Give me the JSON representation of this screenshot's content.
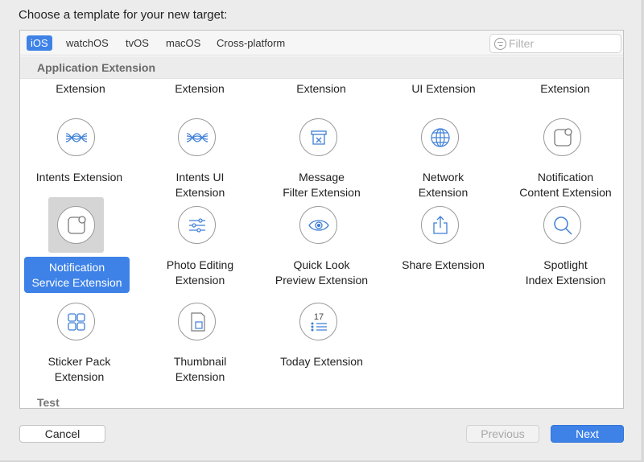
{
  "dialog": {
    "title": "Choose a template for your new target:"
  },
  "tabs": [
    {
      "label": "iOS",
      "active": true
    },
    {
      "label": "watchOS"
    },
    {
      "label": "tvOS"
    },
    {
      "label": "macOS"
    },
    {
      "label": "Cross-platform"
    }
  ],
  "filter": {
    "placeholder": "Filter",
    "value": ""
  },
  "section": {
    "title": "Application Extension",
    "next_title": "Test"
  },
  "partial_row": [
    "Extension",
    "Extension",
    "Extension",
    "UI Extension",
    "Extension"
  ],
  "templates": [
    {
      "line1": "Intents Extension",
      "line2": "",
      "icon": "intents-icon"
    },
    {
      "line1": "Intents UI",
      "line2": "Extension",
      "icon": "intents-ui-icon"
    },
    {
      "line1": "Message",
      "line2": "Filter Extension",
      "icon": "message-filter-icon"
    },
    {
      "line1": "Network",
      "line2": "Extension",
      "icon": "network-globe-icon"
    },
    {
      "line1": "Notification",
      "line2": "Content Extension",
      "icon": "notification-content-icon"
    },
    {
      "line1": "Notification",
      "line2": "Service Extension",
      "icon": "notification-service-icon",
      "selected": true
    },
    {
      "line1": "Photo Editing",
      "line2": "Extension",
      "icon": "photo-editing-sliders-icon"
    },
    {
      "line1": "Quick Look",
      "line2": "Preview Extension",
      "icon": "quick-look-eye-icon"
    },
    {
      "line1": "Share Extension",
      "line2": "",
      "icon": "share-icon"
    },
    {
      "line1": "Spotlight",
      "line2": "Index Extension",
      "icon": "spotlight-search-icon"
    },
    {
      "line1": "Sticker Pack",
      "line2": "Extension",
      "icon": "sticker-pack-icon"
    },
    {
      "line1": "Thumbnail",
      "line2": "Extension",
      "icon": "thumbnail-icon"
    },
    {
      "line1": "Today Extension",
      "line2": "",
      "icon": "today-calendar-icon",
      "date": "17"
    }
  ],
  "buttons": {
    "cancel": "Cancel",
    "previous": "Previous",
    "next": "Next"
  },
  "colors": {
    "accent": "#3e82e8",
    "icon_stroke": "#3e7fd6"
  }
}
